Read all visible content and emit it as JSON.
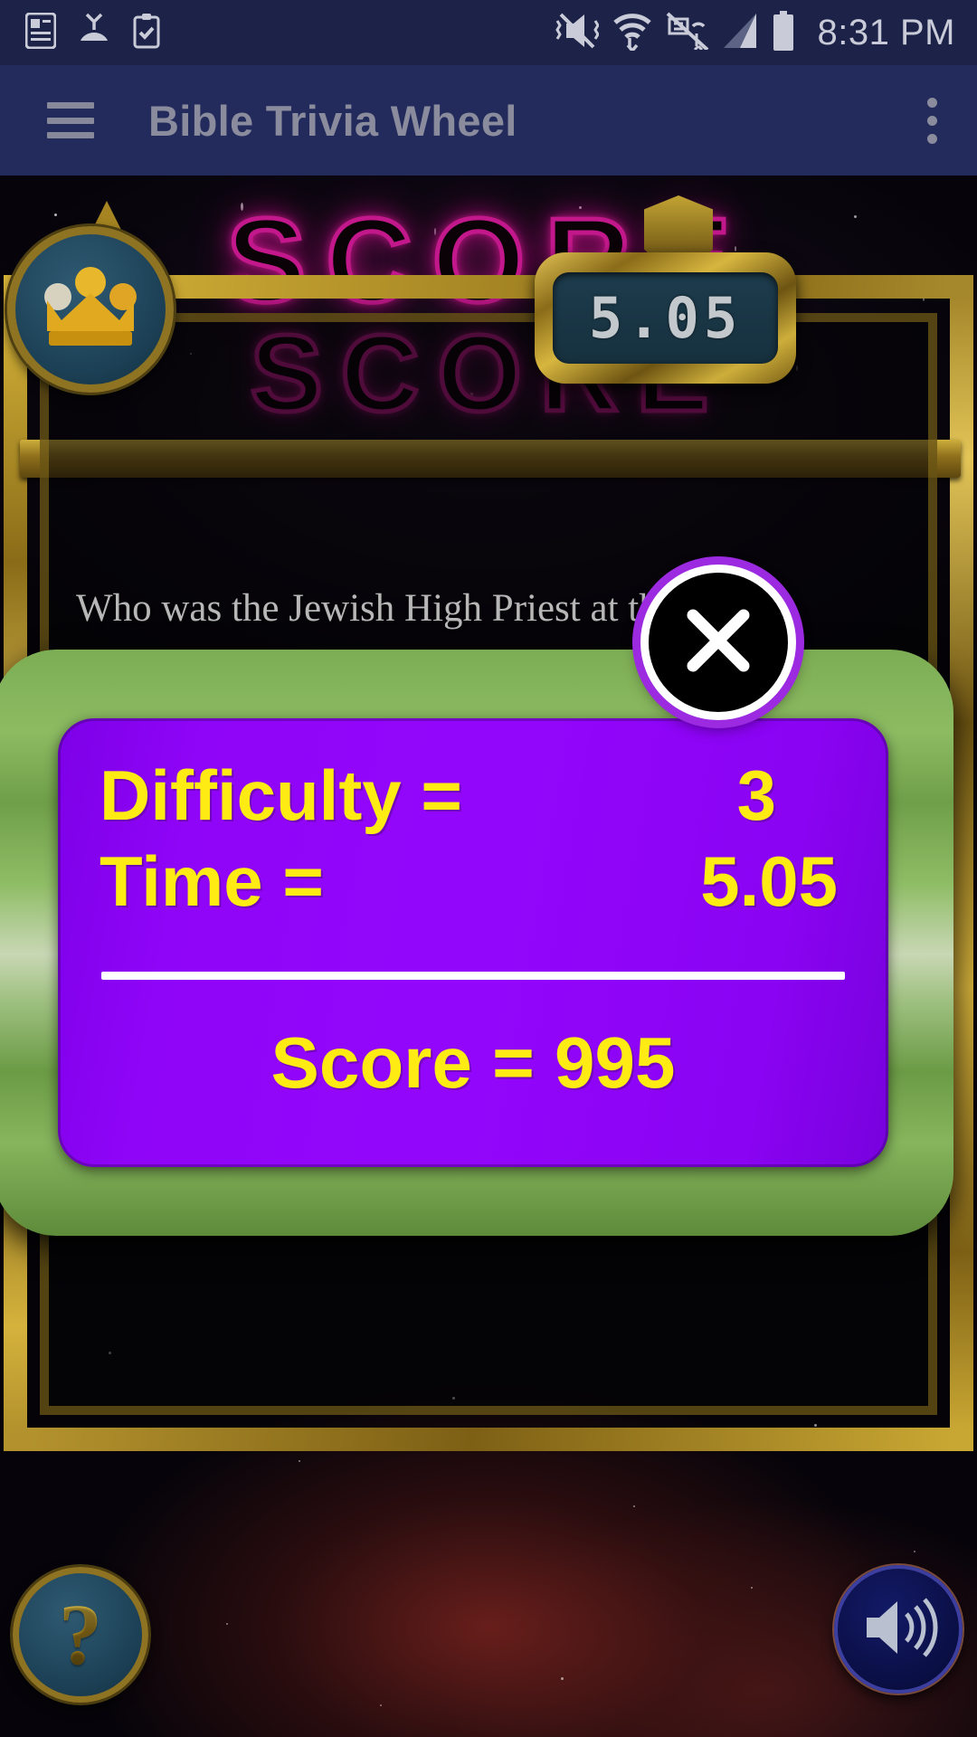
{
  "statusbar": {
    "time": "8:31 PM",
    "left_icons": [
      "contact-card-icon",
      "missed-call-icon",
      "clipboard-check-icon"
    ],
    "right_icons": [
      "vibrate-mute-icon",
      "wifi-data-icon",
      "mobile-data-off-icon",
      "signal-bars-icon",
      "battery-icon"
    ]
  },
  "appbar": {
    "title": "Bible Trivia Wheel",
    "menu_icon": "hamburger-menu-icon",
    "overflow_icon": "overflow-menu-icon",
    "colors": {
      "background": "#232b5c",
      "title": "#8a8c9d"
    }
  },
  "game": {
    "score_title": "SCORE",
    "score_title_shadow": "SCORE",
    "question": "Who was the Jewish High Priest at th",
    "timer": {
      "value": "5.05",
      "icon": "shield-icon"
    },
    "crown_icon": "crown-icon",
    "help_button": {
      "label": "?",
      "icon": "question-mark-icon"
    },
    "sound_button": {
      "icon": "speaker-volume-icon"
    },
    "colors": {
      "neon": "#c8198f",
      "gold": "#cdae3c",
      "badge_fill": "#1d4258"
    }
  },
  "dialog": {
    "rows": [
      {
        "label": "Difficulty =",
        "value": "3"
      },
      {
        "label": "Time =",
        "value": "5.05"
      }
    ],
    "score_line": "Score = 995",
    "close_button": {
      "icon": "close-x-icon",
      "label": "✕"
    },
    "colors": {
      "bezel": "#8cbb62",
      "panel": "#9306fc",
      "text": "#ffeb14",
      "divider": "#ffffff",
      "close_ring": "#9b2ae0"
    }
  }
}
